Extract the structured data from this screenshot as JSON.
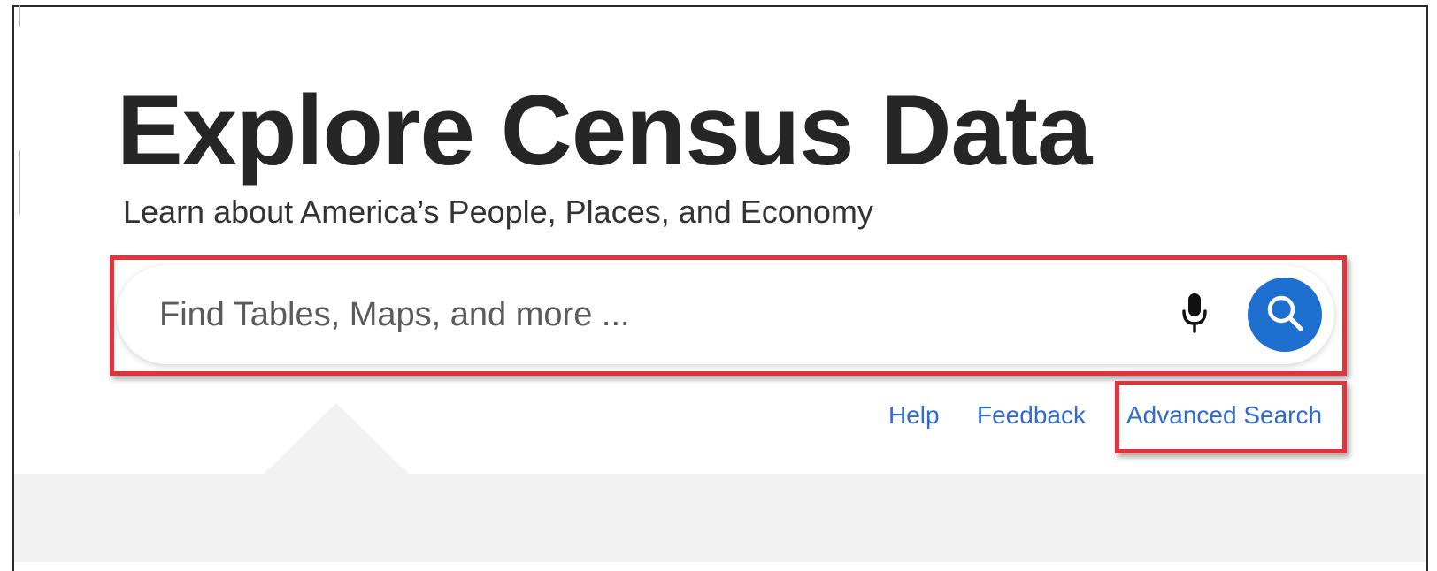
{
  "header": {
    "title": "Explore Census Data",
    "subtitle": "Learn about America’s People, Places, and Economy"
  },
  "search": {
    "placeholder": "Find Tables, Maps, and more ...",
    "value": "",
    "mic_icon": "microphone-icon",
    "search_icon": "magnifier-icon",
    "button_color": "#1f6fd1"
  },
  "links": {
    "help": "Help",
    "feedback": "Feedback",
    "advanced_search": "Advanced Search",
    "color": "#2f6bd0"
  },
  "annotations": {
    "highlight_color": "#e2343c"
  }
}
